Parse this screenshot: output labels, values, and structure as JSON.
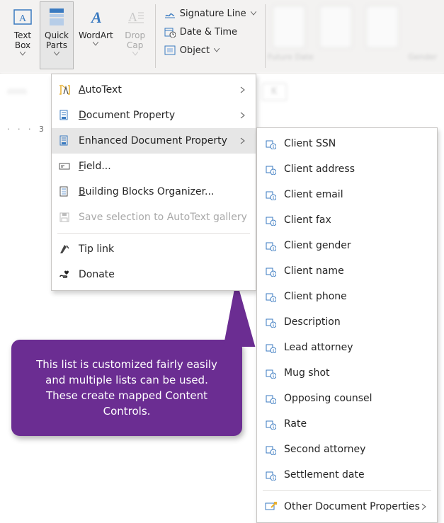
{
  "ribbon": {
    "textBox_label": "Text\nBox",
    "quickParts_label": "Quick\nParts",
    "wordArt_label": "WordArt",
    "dropCap_label": "Drop\nCap",
    "signatureLine_label": "Signature Line",
    "dateTime_label": "Date & Time",
    "object_label": "Object"
  },
  "blurred": {
    "futureDate": "Future Date",
    "gender": "Gender",
    "tab_k": "K"
  },
  "ruler": "· · · 3 · · ·",
  "quickPartsMenu": {
    "autoText_accessKey": "A",
    "autoText_rest": "utoText",
    "documentProperty_accessKey": "D",
    "documentProperty_rest": "ocument Property",
    "enhancedDocProp_label": "Enhanced Document Property",
    "field_accessKey": "F",
    "field_rest": "ield...",
    "bbo_accessKey": "B",
    "bbo_rest": "uilding Blocks Organizer...",
    "saveSelection_label": "Save selection to AutoText gallery",
    "tipLink_label": "Tip link",
    "donate_label": "Donate"
  },
  "submenu": {
    "items": [
      "Client SSN",
      "Client address",
      "Client email",
      "Client fax",
      "Client gender",
      "Client name",
      "Client phone",
      "Description",
      "Lead attorney",
      "Mug shot",
      "Opposing counsel",
      "Rate",
      "Second attorney",
      "Settlement date"
    ],
    "otherProps_label": "Other Document Properties"
  },
  "callout": {
    "line1": "This list is customized fairly easily",
    "line2": "and multiple lists can be used.",
    "line3": "These create mapped Content",
    "line4": "Controls."
  },
  "colors": {
    "accent_purple": "#6b2d92",
    "menu_hover": "#e6e6e6"
  }
}
